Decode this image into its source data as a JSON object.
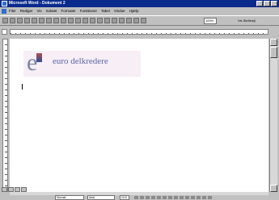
{
  "window": {
    "title": "Microsoft Word - Dokument 2"
  },
  "menu": {
    "items": [
      "Filer",
      "Rediger",
      "Vis",
      "Indsæt",
      "Formater",
      "Funktioner",
      "Tabel",
      "Vindue",
      "Hjælp"
    ]
  },
  "toolbar": {
    "zoom": "100%",
    "right_text": "Vis  Skriftvejl"
  },
  "document": {
    "logo_text": "euro delkredere"
  },
  "format_bar": {
    "style": "Normal",
    "font": "Arial",
    "size": "10,5"
  }
}
